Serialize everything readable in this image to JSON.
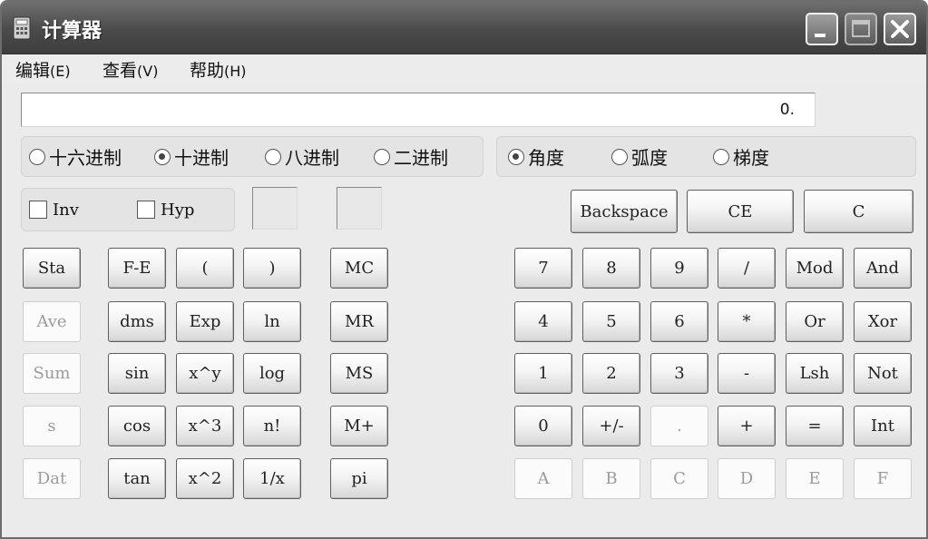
{
  "window": {
    "title": "计算器"
  },
  "menu": [
    {
      "label": "编辑",
      "accel": "(E)"
    },
    {
      "label": "查看",
      "accel": "(V)"
    },
    {
      "label": "帮助",
      "accel": "(H)"
    }
  ],
  "display": {
    "value": "0."
  },
  "number_base": {
    "options": [
      "十六进制",
      "十进制",
      "八进制",
      "二进制"
    ],
    "selected": "十进制"
  },
  "angle_unit": {
    "options": [
      "角度",
      "弧度",
      "梯度"
    ],
    "selected": "角度"
  },
  "checkboxes": [
    "Inv",
    "Hyp"
  ],
  "edit_keys": [
    "Backspace",
    "CE",
    "C"
  ],
  "stat_keys": [
    "Sta",
    "Ave",
    "Sum",
    "s",
    "Dat"
  ],
  "sci_keys": [
    [
      "F-E",
      "(",
      ")"
    ],
    [
      "dms",
      "Exp",
      "ln"
    ],
    [
      "sin",
      "x^y",
      "log"
    ],
    [
      "cos",
      "x^3",
      "n!"
    ],
    [
      "tan",
      "x^2",
      "1/x"
    ]
  ],
  "mem_keys": [
    "MC",
    "MR",
    "MS",
    "M+",
    "pi"
  ],
  "num_keys": [
    [
      "7",
      "8",
      "9",
      "/",
      "Mod",
      "And"
    ],
    [
      "4",
      "5",
      "6",
      "*",
      "Or",
      "Xor"
    ],
    [
      "1",
      "2",
      "3",
      "-",
      "Lsh",
      "Not"
    ],
    [
      "0",
      "+/-",
      ".",
      "+",
      "=",
      "Int"
    ],
    [
      "A",
      "B",
      "C",
      "D",
      "E",
      "F"
    ]
  ],
  "disabled_keys": [
    "Ave",
    "Sum",
    "s",
    "Dat",
    ".",
    "A",
    "B",
    "C",
    "D",
    "E",
    "F"
  ],
  "colors": {
    "titlebar": "#4a4a4a",
    "window_bg": "#ebebeb",
    "key_border": "#5f5f5f"
  }
}
